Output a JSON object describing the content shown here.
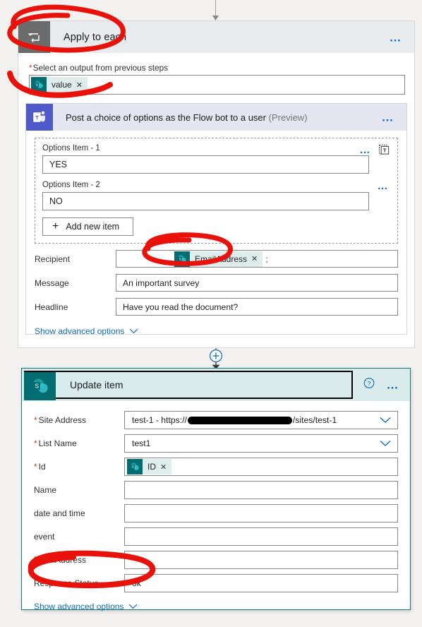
{
  "loop": {
    "title": "Apply to each",
    "icon": "loop-icon",
    "menu": "…",
    "output_label": "Select an output from previous steps",
    "required_marker": "*",
    "output_token": {
      "text": "value",
      "remove": "✕",
      "icon": "sharepoint-icon"
    }
  },
  "teams_action": {
    "title": "Post a choice of options as the Flow bot to a user",
    "preview_tag": "(Preview)",
    "icon": "teams-icon",
    "menu": "…",
    "options": [
      {
        "label": "Options Item - 1",
        "value": "YES",
        "menu": "…",
        "has_expression_icon": true
      },
      {
        "label": "Options Item - 2",
        "value": "NO",
        "menu": "…",
        "has_expression_icon": false
      }
    ],
    "add_item_label": "Add new item",
    "add_item_plus": "+",
    "fields": [
      {
        "label": "Recipient",
        "value": "",
        "token": {
          "text": "EmailAddress",
          "remove": "✕"
        },
        "trailing": ";"
      },
      {
        "label": "Message",
        "value": "An important survey"
      },
      {
        "label": "Headline",
        "value": "Have you read the document?"
      }
    ],
    "advanced_label": "Show advanced options"
  },
  "connector": {
    "add_icon": "plus-circle-icon",
    "arrow": "down-arrow-icon"
  },
  "update_item": {
    "title": "Update item",
    "icon": "sharepoint-icon",
    "help": "?",
    "menu": "…",
    "rows": [
      {
        "label": "Site Address",
        "required": true,
        "value_prefix": "test-1 - https://",
        "redacted": true,
        "value_suffix": "/sites/test-1",
        "dropdown": true
      },
      {
        "label": "List Name",
        "required": true,
        "value": "test1",
        "dropdown": true
      },
      {
        "label": "Id",
        "required": true,
        "value": "",
        "token": {
          "text": "ID",
          "remove": "✕"
        }
      },
      {
        "label": "Name",
        "required": false,
        "value": ""
      },
      {
        "label": "date and time",
        "required": false,
        "value": ""
      },
      {
        "label": "event",
        "required": false,
        "value": ""
      },
      {
        "label": "EmailAddress",
        "required": false,
        "value": ""
      },
      {
        "label": "Response Status",
        "required": false,
        "value": "ok"
      }
    ],
    "advanced_label": "Show advanced options"
  },
  "colors": {
    "teams_purple": "#5059C9",
    "sharepoint_teal": "#036C70",
    "link_blue": "#0F6CBD",
    "required_red": "#D13438",
    "annotation_red": "#E8120B",
    "loop_gray": "#6B6B6B"
  }
}
